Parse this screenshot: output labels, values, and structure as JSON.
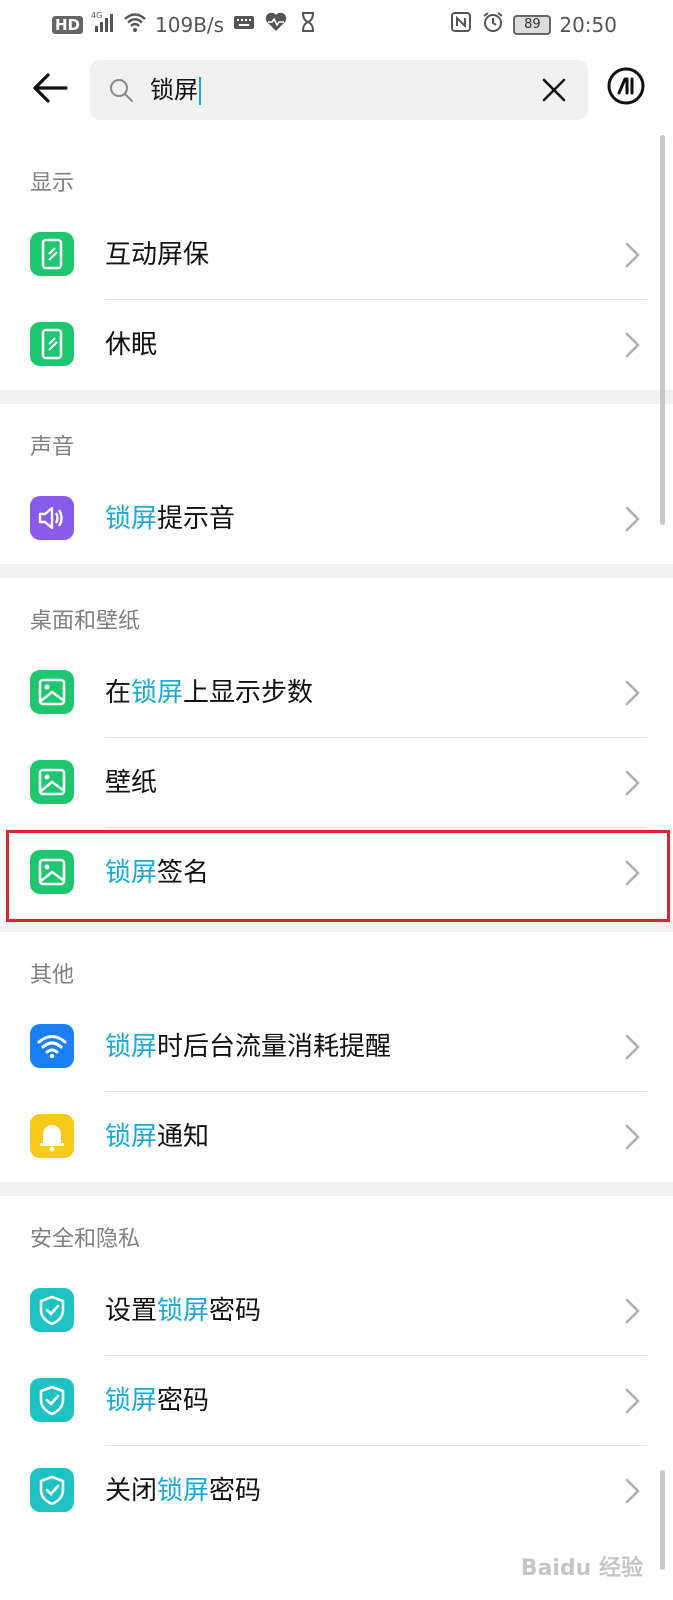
{
  "status_bar": {
    "network": "HD",
    "signal_type": "4G",
    "speed": "109B/s",
    "battery": "89",
    "time": "20:50"
  },
  "search": {
    "query": "锁屏"
  },
  "sections": [
    {
      "title": "显示",
      "items": [
        {
          "pre": "互动屏保",
          "hl": "",
          "post": "",
          "icon": "phone-icon",
          "color": "#1ec66f"
        },
        {
          "pre": "休眠",
          "hl": "",
          "post": "",
          "icon": "phone-icon",
          "color": "#1ec66f"
        }
      ]
    },
    {
      "title": "声音",
      "items": [
        {
          "pre": "",
          "hl": "锁屏",
          "post": "提示音",
          "icon": "speaker-icon",
          "color": "#8a5ae8"
        }
      ]
    },
    {
      "title": "桌面和壁纸",
      "items": [
        {
          "pre": "在",
          "hl": "锁屏",
          "post": "上显示步数",
          "icon": "image-icon",
          "color": "#1ec66f"
        },
        {
          "pre": "壁纸",
          "hl": "",
          "post": "",
          "icon": "image-icon",
          "color": "#1ec66f"
        },
        {
          "pre": "",
          "hl": "锁屏",
          "post": "签名",
          "icon": "image-icon",
          "color": "#1ec66f"
        }
      ]
    },
    {
      "title": "其他",
      "items": [
        {
          "pre": "",
          "hl": "锁屏",
          "post": "时后台流量消耗提醒",
          "icon": "wifi-icon",
          "color": "#1a7ef7"
        },
        {
          "pre": "",
          "hl": "锁屏",
          "post": "通知",
          "icon": "bell-icon",
          "color": "#f7c91a"
        }
      ]
    },
    {
      "title": "安全和隐私",
      "items": [
        {
          "pre": "设置",
          "hl": "锁屏",
          "post": "密码",
          "icon": "shield-icon",
          "color": "#1ec2c4"
        },
        {
          "pre": "",
          "hl": "锁屏",
          "post": "密码",
          "icon": "shield-icon",
          "color": "#1ec2c4"
        },
        {
          "pre": "关闭",
          "hl": "锁屏",
          "post": "密码",
          "icon": "shield-icon",
          "color": "#1ec2c4"
        }
      ]
    }
  ],
  "colors": {
    "highlight": "#1aa9d6",
    "annotation_box": "#d9272e"
  },
  "watermark": "Baidu 经验"
}
